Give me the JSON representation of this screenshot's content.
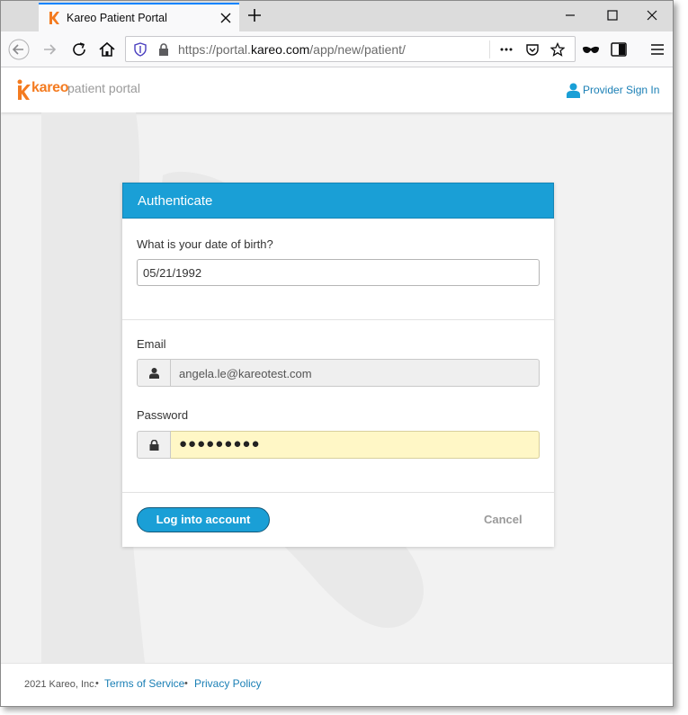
{
  "browser": {
    "tab_title": "Kareo Patient Portal",
    "url_prefix": "https://portal.",
    "url_domain": "kareo.com",
    "url_suffix": "/app/new/patient/",
    "accent": "#0a84ff"
  },
  "header": {
    "logo_word": "kareo",
    "logo_tagline": "patient portal",
    "provider_signin": "Provider Sign In",
    "brand_orange": "#f47b20"
  },
  "card": {
    "title": "Authenticate",
    "dob_label": "What is your date of birth?",
    "dob_value": "05/21/1992",
    "email_label": "Email",
    "email_value": "angela.le@kareotest.com",
    "password_label": "Password",
    "password_value": "●●●●●●●●●",
    "login_label": "Log into account",
    "cancel_label": "Cancel",
    "accent": "#1a9fd6"
  },
  "footer": {
    "copyright": "2021 Kareo, Inc.",
    "sep1": "•",
    "terms": "Terms of Service",
    "sep2": "•",
    "privacy": "Privacy Policy"
  }
}
